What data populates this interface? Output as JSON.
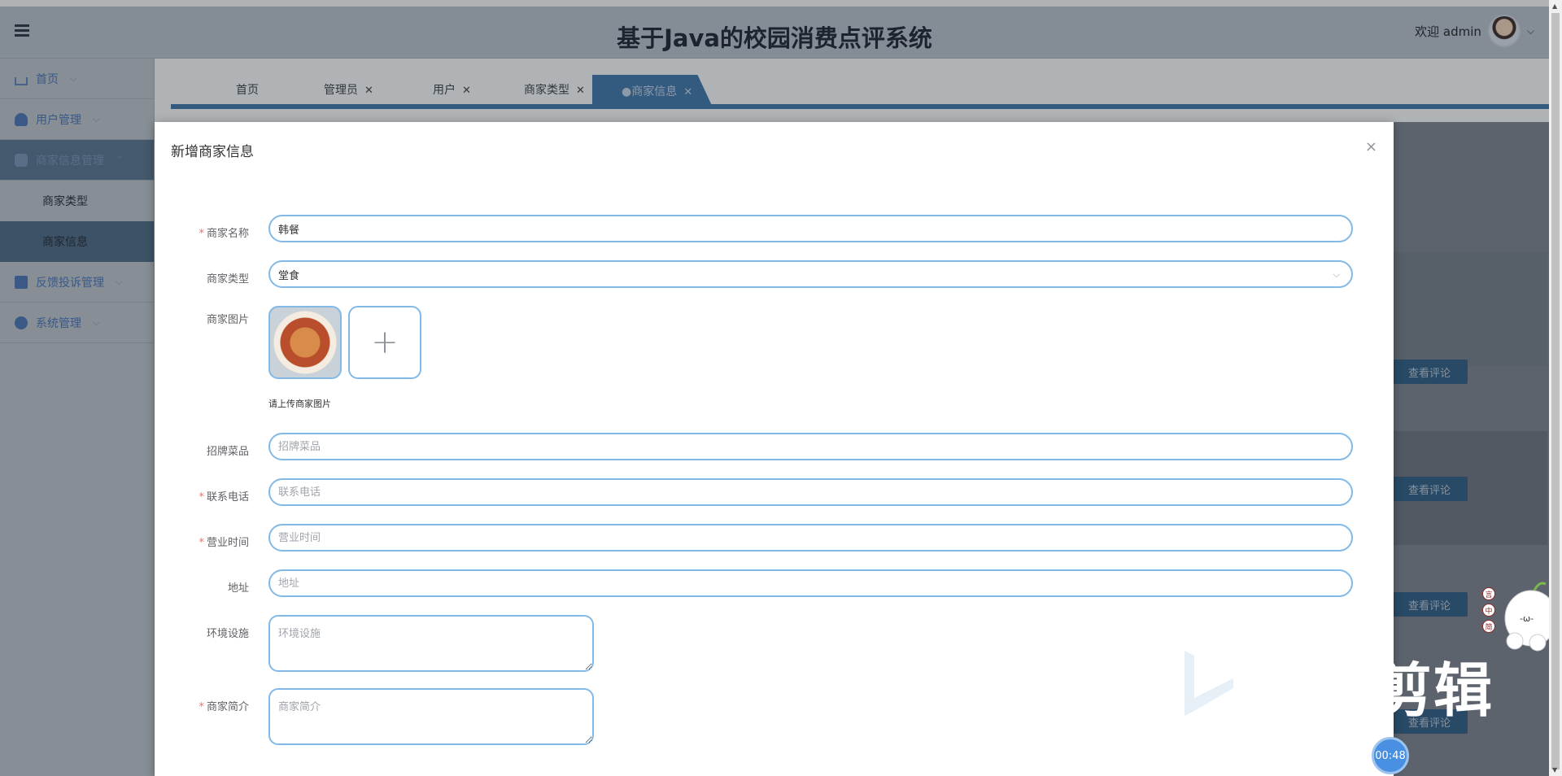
{
  "app": {
    "title": "基于Java的校园消费点评系统",
    "welcome": "欢迎 admin"
  },
  "sidebar": {
    "items": [
      {
        "label": "首页"
      },
      {
        "label": "用户管理"
      },
      {
        "label": "商家信息管理"
      },
      {
        "label": "商家类型"
      },
      {
        "label": "商家信息"
      },
      {
        "label": "反馈投诉管理"
      },
      {
        "label": "系统管理"
      }
    ]
  },
  "tabs": [
    {
      "label": "首页"
    },
    {
      "label": "管理员"
    },
    {
      "label": "用户"
    },
    {
      "label": "商家类型"
    },
    {
      "label": "●商家信息"
    }
  ],
  "background": {
    "button_label": "查看评论"
  },
  "modal": {
    "title": "新增商家信息",
    "close": "×",
    "fields": {
      "name": {
        "label": "商家名称",
        "value": "韩餐"
      },
      "type": {
        "label": "商家类型",
        "value": "堂食"
      },
      "image": {
        "label": "商家图片",
        "hint": "请上传商家图片",
        "add": "+"
      },
      "dish": {
        "label": "招牌菜品",
        "placeholder": "招牌菜品"
      },
      "phone": {
        "label": "联系电话",
        "placeholder": "联系电话"
      },
      "hours": {
        "label": "营业时间",
        "placeholder": "营业时间"
      },
      "address": {
        "label": "地址",
        "placeholder": "地址"
      },
      "facilities": {
        "label": "环境设施",
        "placeholder": "环境设施"
      },
      "intro": {
        "label": "商家简介",
        "placeholder": "商家简介"
      }
    }
  },
  "overlay": {
    "watermark": "剪辑",
    "timer": "00:48",
    "tools": [
      "言",
      "中",
      "简"
    ]
  },
  "colors": {
    "accent": "#3f79ad",
    "input_border": "#82b9e6",
    "required": "#f56c6c"
  }
}
